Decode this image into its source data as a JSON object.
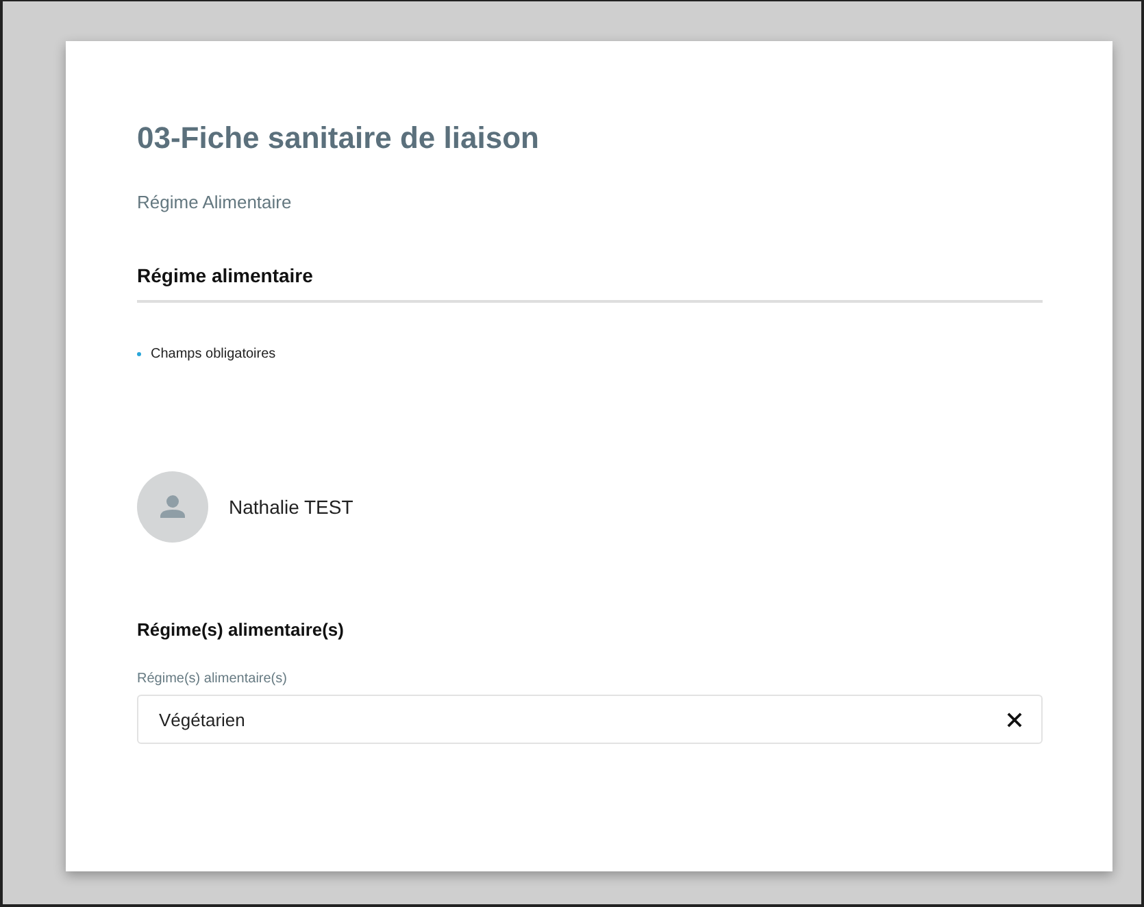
{
  "form": {
    "title": "03-Fiche sanitaire de liaison",
    "subtitle": "Régime Alimentaire",
    "section_heading": "Régime alimentaire",
    "required_note": "Champs obligatoires",
    "person": {
      "name": "Nathalie TEST"
    },
    "field_group": {
      "heading": "Régime(s) alimentaire(s)",
      "label": "Régime(s) alimentaire(s)",
      "value": "Végétarien"
    }
  }
}
